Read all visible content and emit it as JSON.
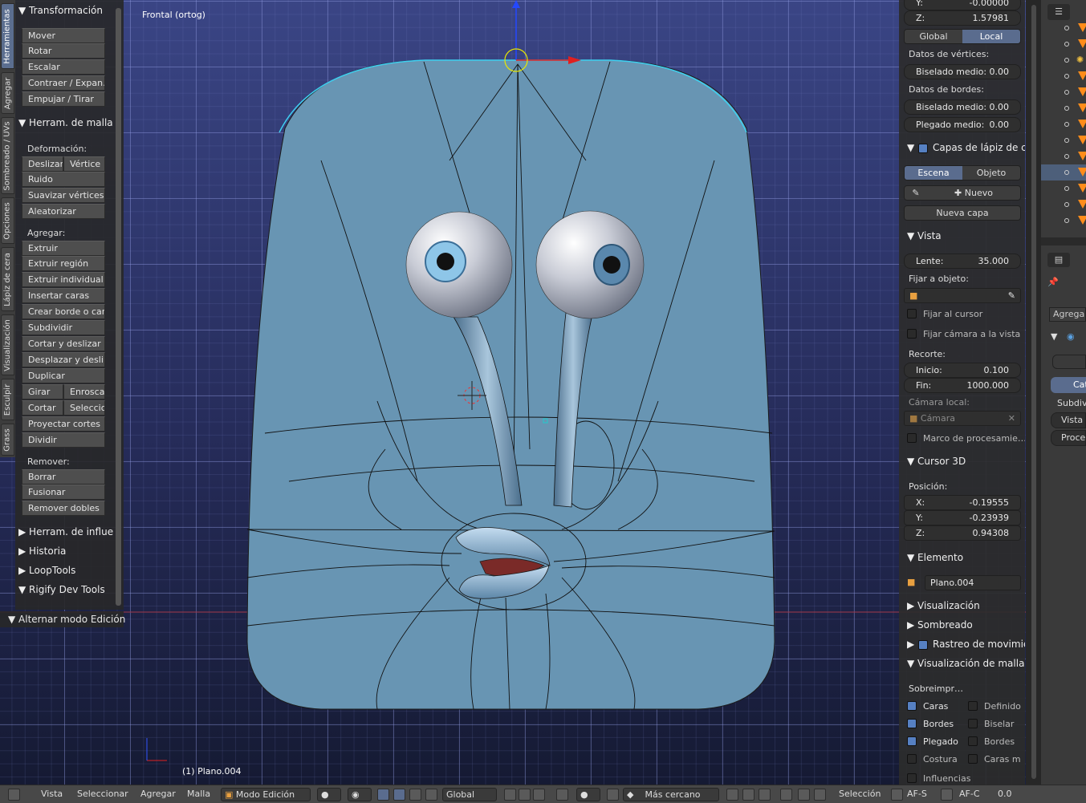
{
  "viewport": {
    "view_label": "Frontal (ortog)",
    "object_label": "(1) Plano.004"
  },
  "tabs": [
    "Herramientas",
    "Agregar",
    "Sombreado / UVs",
    "Opciones",
    "Lápiz de cera",
    "Visualización",
    "Esculpir",
    "Grass"
  ],
  "tools": {
    "transform_title": "Transformación",
    "mover": "Mover",
    "rotar": "Rotar",
    "escalar": "Escalar",
    "contraer": "Contraer / Expan…",
    "empujar": "Empujar / Tirar",
    "mesh_title": "Herram. de malla",
    "deform_label": "Deformación:",
    "deslizar": "Deslizar",
    "vertice": "Vértice",
    "ruido": "Ruido",
    "suavizar": "Suavizar vértices",
    "aleatorizar": "Aleatorizar",
    "add_label": "Agregar:",
    "extruir": "Extruir",
    "extruir_region": "Extruir región",
    "extruir_individual": "Extruir individual",
    "insertar": "Insertar caras",
    "crear": "Crear borde o cara",
    "subdividir": "Subdividir",
    "cortar_deslizar": "Cortar y deslizar …",
    "desplazar": "Desplazar y desli…",
    "duplicar": "Duplicar",
    "girar": "Girar",
    "enroscar": "Enroscar",
    "cortar": "Cortar",
    "seleccio": "Seleccio",
    "proyectar": "Proyectar cortes",
    "dividir": "Dividir",
    "remove_label": "Remover:",
    "borrar": "Borrar",
    "fusionar": "Fusionar",
    "remover_dobles": "Remover dobles",
    "influ": "Herram. de influe",
    "historia": "Historia",
    "looptools": "LoopTools",
    "rigify": "Rigify Dev Tools",
    "toggle_edit": "Alternar modo Edición"
  },
  "props": {
    "y_label": "Y:",
    "y_value": "-0.00000",
    "z_label": "Z:",
    "z_value": "1.57981",
    "global": "Global",
    "local": "Local",
    "vert_data": "Datos de vértices:",
    "bisel_label": "Biselado medio:",
    "bisel_value": "0.00",
    "edge_data": "Datos de bordes:",
    "bisel2_value": "0.00",
    "plegado_label": "Plegado medio:",
    "plegado_value": "0.00",
    "gp_title": "Capas de lápiz de cer",
    "escena": "Escena",
    "objeto": "Objeto",
    "nuevo": "Nuevo",
    "nueva_capa": "Nueva capa",
    "vista_title": "Vista",
    "lente_label": "Lente:",
    "lente_value": "35.000",
    "fijar_obj": "Fijar a objeto:",
    "fijar_cursor": "Fijar al cursor",
    "fijar_camara": "Fijar cámara a la vista",
    "recorte": "Recorte:",
    "inicio_label": "Inicio:",
    "inicio_value": "0.100",
    "fin_label": "Fin:",
    "fin_value": "1000.000",
    "camara_local": "Cámara local:",
    "camara": "Cámara",
    "marco": "Marco de procesamie…",
    "cursor_title": "Cursor 3D",
    "posicion": "Posición:",
    "cx_label": "X:",
    "cx_value": "-0.19555",
    "cy_label": "Y:",
    "cy_value": "-0.23939",
    "cz_label": "Z:",
    "cz_value": "0.94308",
    "elemento_title": "Elemento",
    "elemento_name": "Plano.004",
    "visualizacion": "Visualización",
    "sombreado": "Sombreado",
    "rastreo": "Rastreo de movimien",
    "vis_mallas": "Visualización de mallas",
    "sobreimpr": "Sobreimpr…",
    "caras": "Caras",
    "definido": "Definido",
    "bordes": "Bordes",
    "biselar": "Biselar",
    "plegado": "Plegado",
    "bordes2": "Bordes",
    "costura": "Costura",
    "caras_m": "Caras m",
    "influencias": "Influencias"
  },
  "outliner": {
    "agregar": "Agregar",
    "cat": "Cat",
    "subdiv": "Subdivi",
    "vista": "Vista",
    "proce": "Proce"
  },
  "header": {
    "vista": "Vista",
    "seleccionar": "Seleccionar",
    "agregar": "Agregar",
    "malla": "Malla",
    "modo": "Modo Edición",
    "global": "Global",
    "snap": "Más cercano",
    "seleccion": "Selección",
    "afs": "AF-S",
    "afc": "AF-C",
    "value": "0.0"
  }
}
